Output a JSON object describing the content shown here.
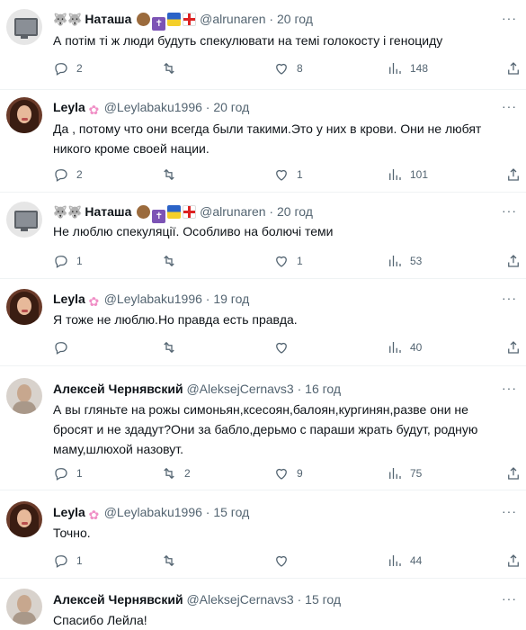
{
  "more_label": "···",
  "tweets": [
    {
      "author": "Наташа",
      "handle": "@alrunaren",
      "time": "20 год",
      "text": "А потім ті ж люди будуть спекулювати на темі голокосту і геноциду",
      "counts": {
        "replies": "2",
        "retweets": "",
        "likes": "8",
        "views": "148"
      }
    },
    {
      "author": "Leyla",
      "handle": "@Leylabaku1996",
      "time": "20 год",
      "text": "Да , потому  что они всегда были такими.Это у них в крови. Они не любят никого кроме своей нации.",
      "counts": {
        "replies": "2",
        "retweets": "",
        "likes": "1",
        "views": "101"
      }
    },
    {
      "author": "Наташа",
      "handle": "@alrunaren",
      "time": "20 год",
      "text": "Не люблю спекуляції. Особливо на болючі теми",
      "counts": {
        "replies": "1",
        "retweets": "",
        "likes": "1",
        "views": "53"
      }
    },
    {
      "author": "Leyla",
      "handle": "@Leylabaku1996",
      "time": "19 год",
      "text": "Я тоже не люблю.Но правда есть правда.",
      "counts": {
        "replies": "",
        "retweets": "",
        "likes": "",
        "views": "40"
      }
    },
    {
      "author": "Алексей Чернявский",
      "handle": "@AleksejCernavs3",
      "time": "16 год",
      "text": "А вы гляньте на рожы симоньян,ксесоян,балоян,кургинян,разве они не бросят и не здадут?Они за бабло,дерьмо с параши жрать будут, родную маму,шлюхой назовут.",
      "counts": {
        "replies": "1",
        "retweets": "2",
        "likes": "9",
        "views": "75"
      }
    },
    {
      "author": "Leyla",
      "handle": "@Leylabaku1996",
      "time": "15 год",
      "text": "Точно.",
      "counts": {
        "replies": "1",
        "retweets": "",
        "likes": "",
        "views": "44"
      }
    },
    {
      "author": "Алексей Чернявский",
      "handle": "@AleksejCernavs3",
      "time": "15 год",
      "text": "Спасибо Лейла!",
      "counts": {
        "replies": "",
        "retweets": "",
        "likes": "",
        "views": ""
      }
    }
  ]
}
